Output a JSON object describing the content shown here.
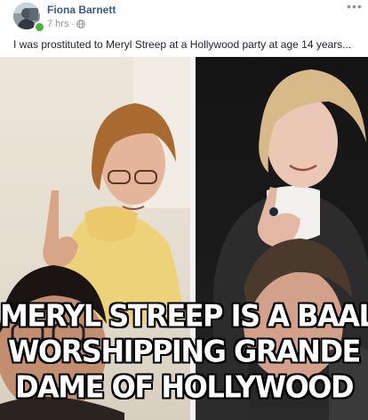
{
  "post": {
    "author": "Fiona Barnett",
    "time": "7 hrs",
    "separator": "·",
    "privacy_icon": "globe-icon",
    "more_icon": "more-options-icon",
    "caption": "I was prostituted to Meryl Streep at a Hollywood party at age 14 years..."
  },
  "meme": {
    "lines": [
      "MERYL STREEP IS A BAAL",
      "WORSHIPPING GRANDE",
      "DAME OF HOLLYWOOD"
    ]
  },
  "colors": {
    "author_link": "#385898",
    "meta_text": "#90949c",
    "online_dot": "#42b72a",
    "meme_text": "#ffffff",
    "meme_outline": "#000000"
  }
}
